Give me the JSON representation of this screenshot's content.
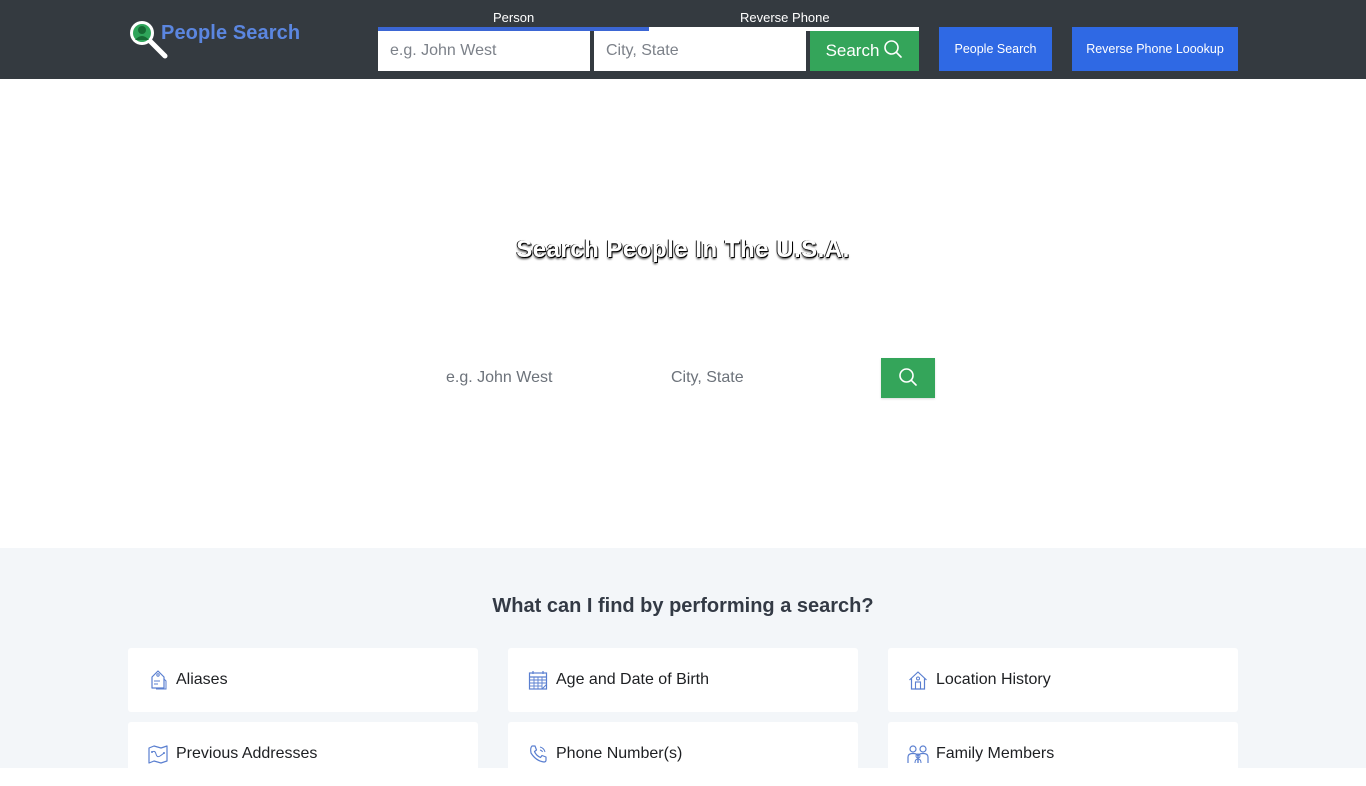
{
  "header": {
    "logo_text": "People Search",
    "tabs": [
      {
        "label": "Person",
        "active": true
      },
      {
        "label": "Reverse Phone",
        "active": false
      }
    ],
    "name_input": {
      "value": "",
      "placeholder": "e.g. John West"
    },
    "location_input": {
      "value": "",
      "placeholder": "City, State"
    },
    "search_button_label": "Search",
    "nav_buttons": [
      {
        "label": "People Search"
      },
      {
        "label": "Reverse Phone Loookup"
      }
    ]
  },
  "hero": {
    "title": "Search People In The U.S.A.",
    "name_input": {
      "value": "",
      "placeholder": "e.g. John West"
    },
    "location_input": {
      "value": "",
      "placeholder": "City, State"
    },
    "search_button_icon": "search-icon"
  },
  "features": {
    "title": "What can I find by performing a search?",
    "items": [
      {
        "label": "Aliases",
        "icon": "tag-icon"
      },
      {
        "label": "Age and Date of Birth",
        "icon": "calendar-icon"
      },
      {
        "label": "Location History",
        "icon": "house-icon"
      },
      {
        "label": "Previous Addresses",
        "icon": "map-icon"
      },
      {
        "label": "Phone Number(s)",
        "icon": "phone-icon"
      },
      {
        "label": "Family Members",
        "icon": "family-icon"
      }
    ]
  },
  "colors": {
    "header_bg": "#343a40",
    "brand_blue": "#5b86e0",
    "button_blue": "#2f69e4",
    "tab_active": "#3b66d4",
    "search_green": "#34a55a",
    "features_bg": "#f3f6f9",
    "icon_blue": "#5a7fd0"
  }
}
